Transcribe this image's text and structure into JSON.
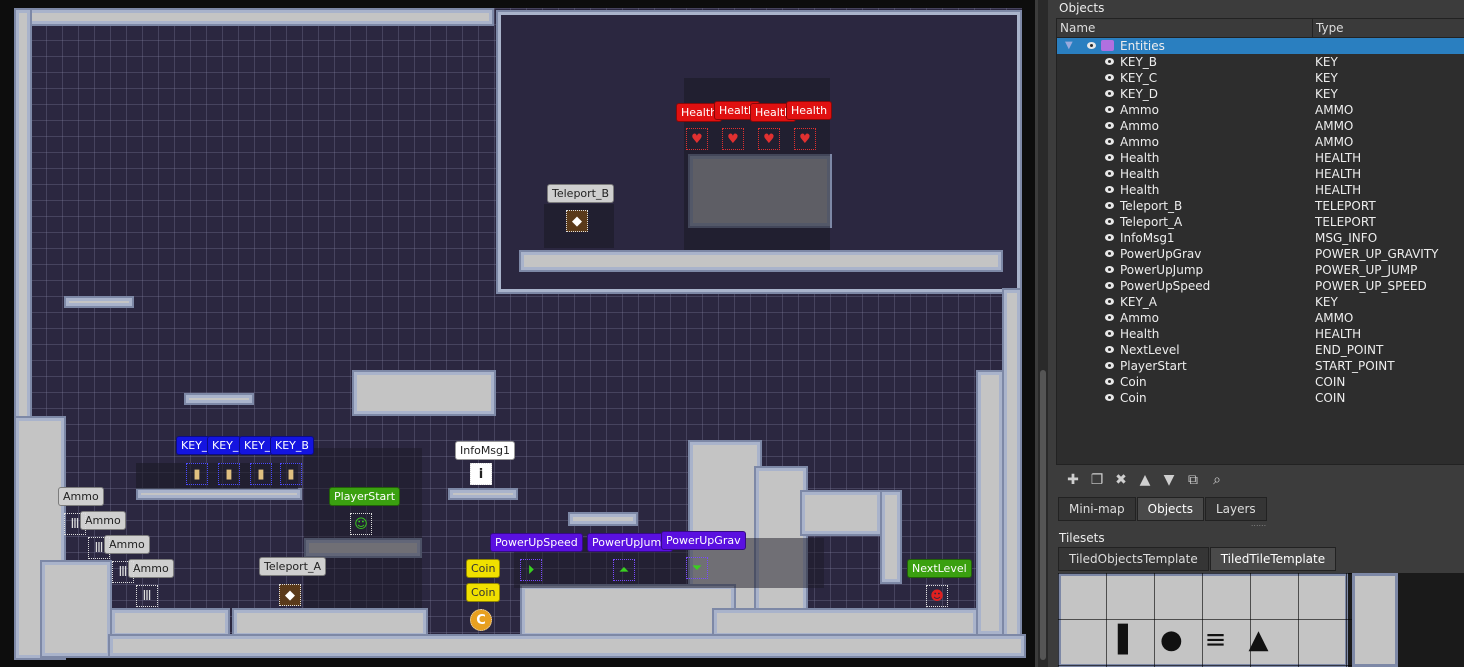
{
  "map": {
    "labels": {
      "health_1": "Health",
      "health_2": "Health",
      "health_3": "Health",
      "health_4": "Health",
      "teleport_b": "Teleport_B",
      "teleport_a": "Teleport_A",
      "key_1": "KEY_/",
      "key_2": "KEY_I",
      "key_3": "KEY_(",
      "key_4": "KEY_B",
      "infomsg": "InfoMsg1",
      "playerstart": "PlayerStart",
      "ammo_1": "Ammo",
      "ammo_2": "Ammo",
      "ammo_3": "Ammo",
      "ammo_4": "Ammo",
      "powerupspeed": "PowerUpSpeed",
      "powerupjump": "PowerUpJump",
      "powerupgrav": "PowerUpGrav",
      "coin_1": "Coin",
      "coin_2": "Coin",
      "nextlevel": "NextLevel"
    },
    "colors": {
      "health": "#e01010",
      "key": "#1414e0",
      "start": "#3aa010",
      "powerup": "#5a10e0",
      "coin": "#f0e000"
    }
  },
  "panel": {
    "title": "Objects",
    "columns": {
      "name": "Name",
      "type": "Type"
    },
    "group": {
      "name": "Entities",
      "icon": "layer-group-icon"
    },
    "rows": [
      {
        "name": "KEY_B",
        "type": "KEY"
      },
      {
        "name": "KEY_C",
        "type": "KEY"
      },
      {
        "name": "KEY_D",
        "type": "KEY"
      },
      {
        "name": "Ammo",
        "type": "AMMO"
      },
      {
        "name": "Ammo",
        "type": "AMMO"
      },
      {
        "name": "Ammo",
        "type": "AMMO"
      },
      {
        "name": "Health",
        "type": "HEALTH"
      },
      {
        "name": "Health",
        "type": "HEALTH"
      },
      {
        "name": "Health",
        "type": "HEALTH"
      },
      {
        "name": "Teleport_B",
        "type": "TELEPORT"
      },
      {
        "name": "Teleport_A",
        "type": "TELEPORT"
      },
      {
        "name": "InfoMsg1",
        "type": "MSG_INFO"
      },
      {
        "name": "PowerUpGrav",
        "type": "POWER_UP_GRAVITY"
      },
      {
        "name": "PowerUpJump",
        "type": "POWER_UP_JUMP"
      },
      {
        "name": "PowerUpSpeed",
        "type": "POWER_UP_SPEED"
      },
      {
        "name": "KEY_A",
        "type": "KEY"
      },
      {
        "name": "Ammo",
        "type": "AMMO"
      },
      {
        "name": "Health",
        "type": "HEALTH"
      },
      {
        "name": "NextLevel",
        "type": "END_POINT"
      },
      {
        "name": "PlayerStart",
        "type": "START_POINT"
      },
      {
        "name": "Coin",
        "type": "COIN"
      },
      {
        "name": "Coin",
        "type": "COIN"
      }
    ],
    "toolbar_icons": [
      "new-object-icon",
      "duplicate-icon",
      "delete-icon",
      "move-up-icon",
      "move-down-icon",
      "move-to-layer-icon",
      "properties-icon"
    ],
    "bottom_tabs": {
      "minimap": "Mini-map",
      "objects": "Objects",
      "layers": "Layers"
    },
    "tilesets_title": "Tilesets",
    "tileset_tabs": {
      "objects_template": "TiledObjectsTemplate",
      "tile_template": "TiledTileTemplate"
    }
  }
}
